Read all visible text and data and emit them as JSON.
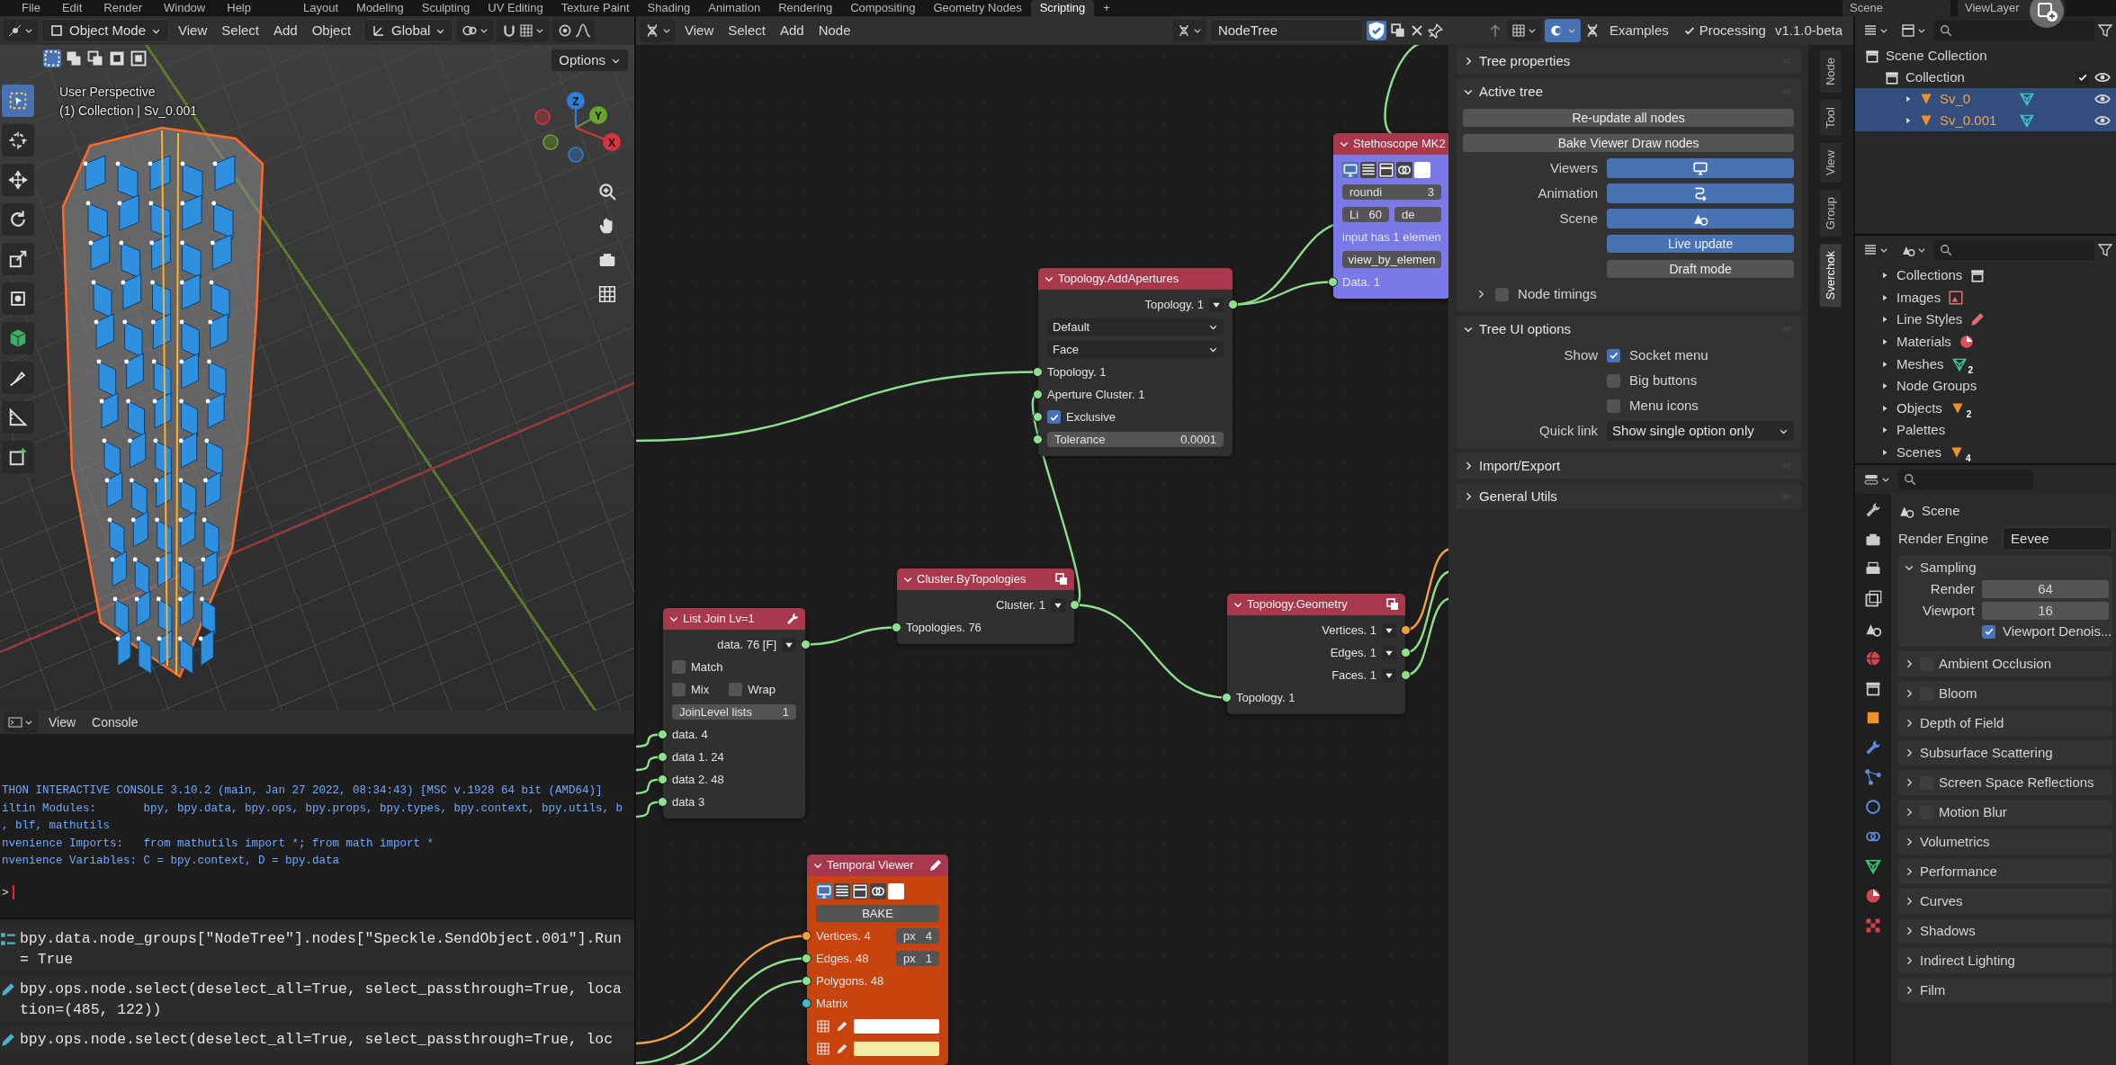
{
  "top_bar": {
    "menus": [
      "File",
      "Edit",
      "Render",
      "Window",
      "Help"
    ],
    "workspaces": [
      {
        "label": "Layout",
        "selected": false
      },
      {
        "label": "Modeling",
        "selected": false
      },
      {
        "label": "Sculpting",
        "selected": false
      },
      {
        "label": "UV Editing",
        "selected": false
      },
      {
        "label": "Texture Paint",
        "selected": false
      },
      {
        "label": "Shading",
        "selected": false
      },
      {
        "label": "Animation",
        "selected": false
      },
      {
        "label": "Rendering",
        "selected": false
      },
      {
        "label": "Compositing",
        "selected": false
      },
      {
        "label": "Geometry Nodes",
        "selected": false
      },
      {
        "label": "Scripting",
        "selected": true
      }
    ],
    "add_workspace": "+",
    "scene": "Scene",
    "view_layer": "ViewLayer"
  },
  "viewport": {
    "mode": "Object Mode",
    "menus": [
      "View",
      "Select",
      "Add",
      "Object"
    ],
    "orientation": "Global",
    "options": "Options",
    "overlay_text": [
      "User Perspective",
      "(1) Collection | Sv_0.001"
    ],
    "axes": [
      "Z",
      "Y",
      "X"
    ]
  },
  "console": {
    "menus": [
      "View",
      "Console"
    ],
    "lines": [
      "THON INTERACTIVE CONSOLE 3.10.2 (main, Jan 27 2022, 08:34:43) [MSC v.1928 64 bit (AMD64)]",
      "iltin Modules:       bpy, bpy.data, bpy.ops, bpy.props, bpy.types, bpy.context, bpy.utils, b",
      ", blf, mathutils",
      "nvenience Imports:   from mathutils import *; from math import *",
      "nvenience Variables: C = bpy.context, D = bpy.data"
    ],
    "prompt": ">"
  },
  "info_log": {
    "entries": [
      {
        "kind": "property",
        "text": "bpy.data.node_groups[\"NodeTree\"].nodes[\"Speckle.SendObject.001\"].Run = True"
      },
      {
        "kind": "operator",
        "text": "bpy.ops.node.select(deselect_all=True, select_passthrough=True, location=(485, 122))"
      },
      {
        "kind": "operator",
        "text": "bpy.ops.node.select(deselect_all=True, select_passthrough=True, loc"
      }
    ]
  },
  "node_editor": {
    "menus": [
      "View",
      "Select",
      "Add",
      "Node"
    ],
    "tree_name": "NodeTree",
    "examples": "Examples",
    "processing": {
      "label": "Processing",
      "checked": true
    },
    "version": "v1.1.0-beta",
    "nodes": [
      {
        "title": "Stethoscope MK2",
        "color": "#7b79e8",
        "rows": [
          {
            "kind": "icons"
          },
          {
            "kind": "fields",
            "items": [
              {
                "label": "roundi",
                "value": "3"
              }
            ]
          },
          {
            "kind": "fields",
            "items": [
              {
                "label": "Li",
                "value": "60"
              },
              {
                "label": "de"
              }
            ]
          },
          {
            "kind": "text",
            "label": "input has 1 elemen"
          },
          {
            "kind": "button",
            "label": "view_by_elemen"
          },
          {
            "kind": "input",
            "label": "Data. 1",
            "color": "#8ee08e"
          }
        ]
      },
      {
        "title": "Topology.AddApertures",
        "color": "#303030",
        "rows": [
          {
            "kind": "output",
            "label": "Topology. 1",
            "color": "#8ee08e"
          },
          {
            "kind": "dropdown",
            "label": "Default"
          },
          {
            "kind": "dropdown",
            "label": "Face"
          },
          {
            "kind": "input",
            "label": "Topology. 1",
            "color": "#8ee08e"
          },
          {
            "kind": "input",
            "label": "Aperture Cluster. 1",
            "color": "#8ee08e"
          },
          {
            "kind": "checkbox",
            "items": [
              {
                "label": "Exclusive",
                "checked": true
              }
            ],
            "color": "#8ee08e"
          },
          {
            "kind": "fields",
            "items": [
              {
                "label": "Tolerance",
                "value": "0.0001"
              }
            ],
            "color": "#8ee08e"
          }
        ]
      },
      {
        "title": "Cluster.ByTopologies",
        "color": "#303030",
        "rows": [
          {
            "kind": "output",
            "label": "Cluster. 1",
            "color": "#8ee08e"
          },
          {
            "kind": "input",
            "label": "Topologies. 76",
            "color": "#8ee08e"
          }
        ]
      },
      {
        "title": "Topology.Geometry",
        "color": "#303030",
        "rows": [
          {
            "kind": "output",
            "label": "Vertices. 1",
            "color": "#f0a040"
          },
          {
            "kind": "output",
            "label": "Edges. 1",
            "color": "#8ee08e"
          },
          {
            "kind": "output",
            "label": "Faces. 1",
            "color": "#8ee08e"
          },
          {
            "kind": "input",
            "label": "Topology. 1",
            "color": "#8ee08e"
          }
        ]
      },
      {
        "title": "List Join Lv=1",
        "color": "#303030",
        "rows": [
          {
            "kind": "output",
            "label": "data. 76 [F]",
            "color": "#8ee08e"
          },
          {
            "kind": "checkbox",
            "items": [
              {
                "label": "Match",
                "checked": false
              }
            ]
          },
          {
            "kind": "checkbox",
            "items": [
              {
                "label": "Mix",
                "checked": false
              },
              {
                "label": "Wrap",
                "checked": false
              }
            ]
          },
          {
            "kind": "fields",
            "items": [
              {
                "label": "JoinLevel lists",
                "value": "1"
              }
            ]
          },
          {
            "kind": "input",
            "label": "data. 4",
            "color": "#8ee08e"
          },
          {
            "kind": "input",
            "label": "data 1. 24",
            "color": "#8ee08e"
          },
          {
            "kind": "input",
            "label": "data 2. 48",
            "color": "#8ee08e"
          },
          {
            "kind": "input",
            "label": "data 3",
            "color": "#8ee08e"
          }
        ]
      },
      {
        "title": "Temporal Viewer",
        "color": "#c8440e",
        "rows": [
          {
            "kind": "icons"
          },
          {
            "kind": "button",
            "label": "BAKE"
          },
          {
            "kind": "input",
            "label": "Vertices. 4",
            "color": "#f0a040",
            "field": {
              "label": "px",
              "value": "4"
            }
          },
          {
            "kind": "input",
            "label": "Edges. 48",
            "color": "#8ee08e",
            "field": {
              "label": "px",
              "value": "1"
            }
          },
          {
            "kind": "input",
            "label": "Polygons. 48",
            "color": "#8ee08e"
          },
          {
            "kind": "input",
            "label": "Matrix",
            "color": "#3fb8c8"
          },
          {
            "kind": "swatch",
            "color": "#ffffff"
          },
          {
            "kind": "swatch",
            "color": "#f3eda6"
          }
        ]
      }
    ]
  },
  "sidebar": {
    "tabs": [
      {
        "label": "Node",
        "selected": false
      },
      {
        "label": "Tool",
        "selected": false
      },
      {
        "label": "View",
        "selected": false
      },
      {
        "label": "Group",
        "selected": false
      },
      {
        "label": "Sverchok",
        "selected": true
      }
    ],
    "panels": [
      {
        "title": "Tree properties",
        "expanded": false
      },
      {
        "title": "Active tree",
        "expanded": true,
        "rows": [
          {
            "kind": "button",
            "text": "Re-update all nodes"
          },
          {
            "kind": "button",
            "text": "Bake Viewer Draw nodes"
          },
          {
            "kind": "toggle",
            "label": "Viewers",
            "on": true
          },
          {
            "kind": "toggle",
            "label": "Animation",
            "on": true
          },
          {
            "kind": "toggle",
            "label": "Scene",
            "on": true
          },
          {
            "kind": "toggle",
            "text": "Live update",
            "on": true
          },
          {
            "kind": "toggle",
            "text": "Draft mode",
            "on": false
          },
          {
            "kind": "subpanel",
            "text": "Node timings",
            "checked": false,
            "expanded": false
          }
        ]
      },
      {
        "title": "Tree UI options",
        "expanded": true,
        "rows": [
          {
            "kind": "checkbox",
            "label": "Show",
            "text": "Socket menu",
            "checked": true
          },
          {
            "kind": "checkbox",
            "text": "Big buttons",
            "checked": false
          },
          {
            "kind": "checkbox",
            "text": "Menu icons",
            "checked": false
          },
          {
            "kind": "dropdown",
            "label": "Quick link",
            "text": "Show single option only"
          }
        ]
      },
      {
        "title": "Import/Export",
        "expanded": false
      },
      {
        "title": "General Utils",
        "expanded": false
      }
    ]
  },
  "outliner": {
    "items": [
      {
        "label": "Scene Collection",
        "selected": false,
        "children": [
          {
            "label": "Collection",
            "selected": false,
            "checked": true,
            "children": [
              {
                "label": "Sv_0",
                "selected": true,
                "expanded": false
              },
              {
                "label": "Sv_0.001",
                "selected": true,
                "expanded": false
              }
            ]
          }
        ]
      }
    ]
  },
  "data_browser": {
    "items": [
      {
        "label": "Collections",
        "expanded": false
      },
      {
        "label": "Images",
        "expanded": false
      },
      {
        "label": "Line Styles",
        "expanded": false
      },
      {
        "label": "Materials",
        "expanded": false
      },
      {
        "label": "Meshes",
        "expanded": false,
        "count": "2"
      },
      {
        "label": "Node Groups",
        "expanded": false
      },
      {
        "label": "Objects",
        "expanded": false,
        "count": "2"
      },
      {
        "label": "Palettes",
        "expanded": false
      },
      {
        "label": "Scenes",
        "expanded": false,
        "count": "4"
      }
    ]
  },
  "properties": {
    "title": "Scene",
    "render_engine": {
      "label": "Render Engine",
      "value": "Eevee"
    },
    "panels": [
      {
        "title": "Sampling",
        "expanded": true,
        "rows": [
          {
            "kind": "field",
            "label": "Render",
            "value": "64"
          },
          {
            "kind": "field",
            "label": "Viewport",
            "value": "16"
          },
          {
            "kind": "checkbox",
            "text": "Viewport Denois...",
            "checked": true
          }
        ]
      },
      {
        "title": "Ambient Occlusion",
        "expanded": false,
        "enabled": false
      },
      {
        "title": "Bloom",
        "expanded": false,
        "enabled": false
      },
      {
        "title": "Depth of Field",
        "expanded": false
      },
      {
        "title": "Subsurface Scattering",
        "expanded": false
      },
      {
        "title": "Screen Space Reflections",
        "expanded": false,
        "enabled": false
      },
      {
        "title": "Motion Blur",
        "expanded": false,
        "enabled": false
      },
      {
        "title": "Volumetrics",
        "expanded": false
      },
      {
        "title": "Performance",
        "expanded": false
      },
      {
        "title": "Curves",
        "expanded": false
      },
      {
        "title": "Shadows",
        "expanded": false
      },
      {
        "title": "Indirect Lighting",
        "expanded": false
      },
      {
        "title": "Film",
        "expanded": false
      }
    ]
  }
}
